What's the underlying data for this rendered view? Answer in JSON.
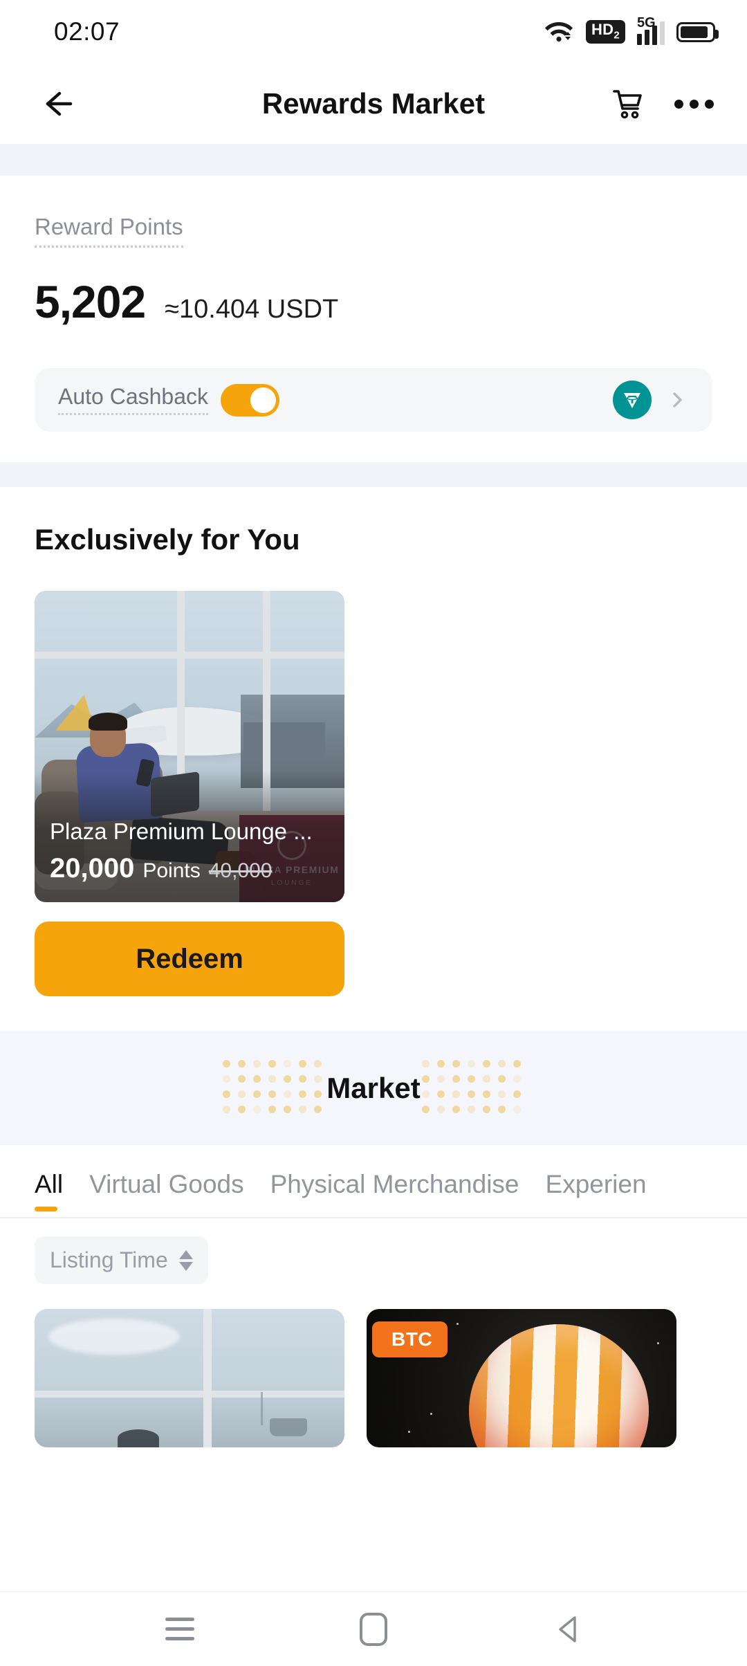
{
  "status_bar": {
    "time": "02:07",
    "icons": {
      "wifi": "wifi-icon",
      "hd_label": "HD",
      "hd_sub": "2",
      "network": "5G",
      "signal_bars": [
        16,
        22,
        28,
        34
      ],
      "battery_level": 88
    }
  },
  "app_bar": {
    "back": "back-arrow-icon",
    "title": "Rewards Market",
    "cart": "shopping-cart-icon",
    "more": "more-options-icon"
  },
  "points_card": {
    "label": "Reward Points",
    "value": "5,202",
    "usdt_equivalent": "≈10.404 USDT",
    "cashback": {
      "label": "Auto Cashback",
      "toggle_on": true,
      "coin_icon": "usdt-coin-icon",
      "chevron": "chevron-right-icon"
    }
  },
  "exclusive": {
    "title": "Exclusively for You",
    "promo": {
      "name": "Plaza Premium Lounge ...",
      "points": "20,000",
      "points_unit": "Points",
      "original_points": "40,000",
      "logo_line1": "PLAZA PREMIUM",
      "logo_line2": "LOUNGE"
    },
    "redeem_label": "Redeem"
  },
  "market": {
    "title": "Market",
    "tabs": [
      {
        "label": "All",
        "active": true
      },
      {
        "label": "Virtual Goods",
        "active": false
      },
      {
        "label": "Physical Merchandise",
        "active": false
      },
      {
        "label": "Experien",
        "active": false
      }
    ],
    "filter": {
      "label": "Listing Time",
      "sort_icon": "sort-arrows-icon"
    },
    "products": [
      {
        "badge": "",
        "image": "airport-lounge-window-photo"
      },
      {
        "badge": "BTC",
        "image": "bitcoin-sphere-graphic"
      }
    ]
  },
  "nav_bar": {
    "recents": "recents-icon",
    "home": "home-icon",
    "back": "back-nav-icon"
  },
  "colors": {
    "accent": "#F5A50B",
    "usdt_teal": "#009393",
    "btc_orange": "#F2731C",
    "band_bg": "#f5f6fb",
    "gap_bg": "#f3f4f9"
  }
}
